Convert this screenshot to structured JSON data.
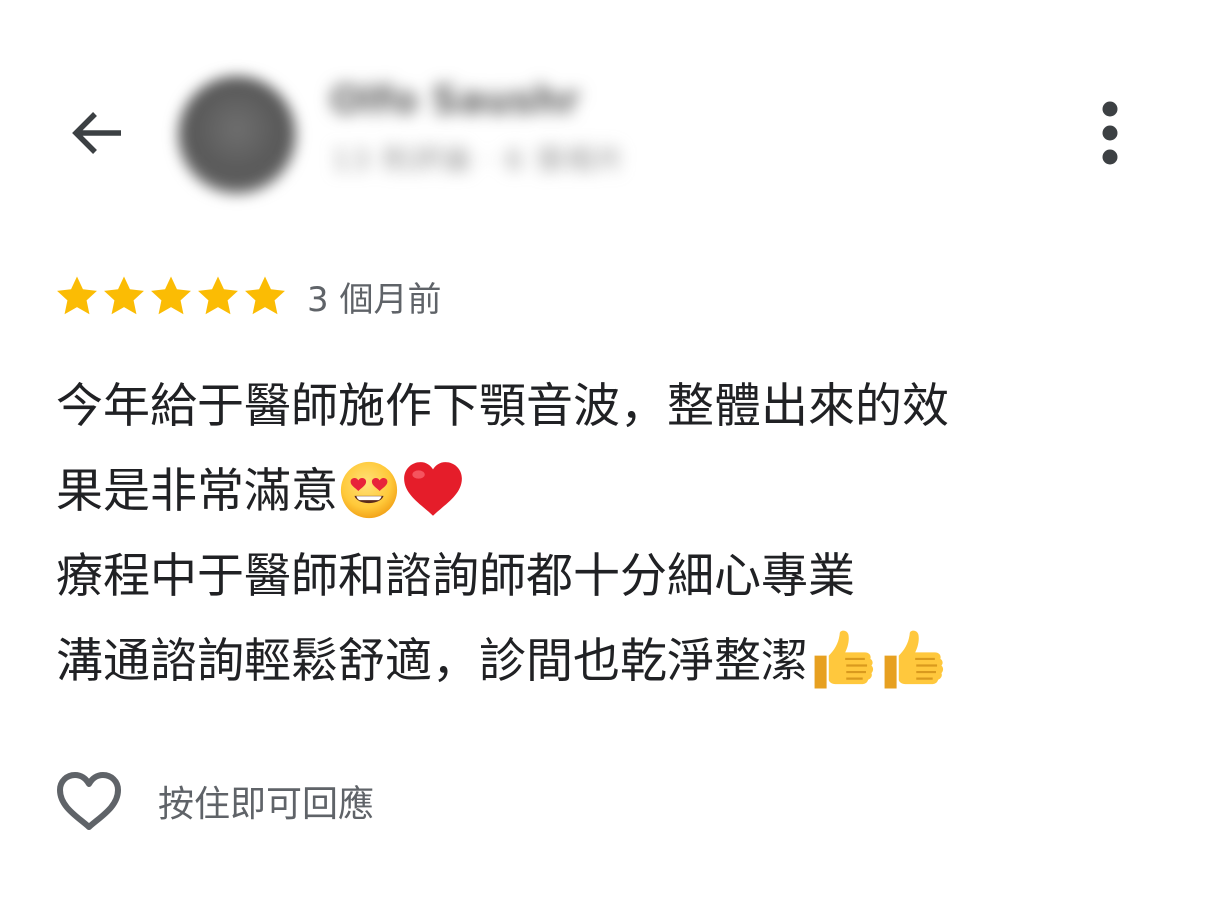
{
  "header": {
    "back_icon": "arrow-back-icon",
    "reviewer_name": "Olfo Saushr",
    "reviewer_meta": "13 則評論 · 6 張相片",
    "more_icon": "more-vertical-icon"
  },
  "rating": {
    "stars": 5,
    "max_stars": 5,
    "star_color": "#FBBC04",
    "time_ago": "3 個月前"
  },
  "review": {
    "lines": [
      "今年給于醫師施作下顎音波，整體出來的效",
      "果是非常滿意",
      "療程中于醫師和諮詢師都十分細心專業",
      "溝通諮詢輕鬆舒適，診間也乾淨整潔"
    ],
    "emojis": {
      "line2": [
        "smiling-face-with-heart-eyes-icon",
        "red-heart-icon"
      ],
      "line4": [
        "thumbs-up-icon",
        "thumbs-up-icon"
      ]
    }
  },
  "actions": {
    "like_icon": "heart-outline-icon",
    "reply_hint": "按住即可回應"
  }
}
